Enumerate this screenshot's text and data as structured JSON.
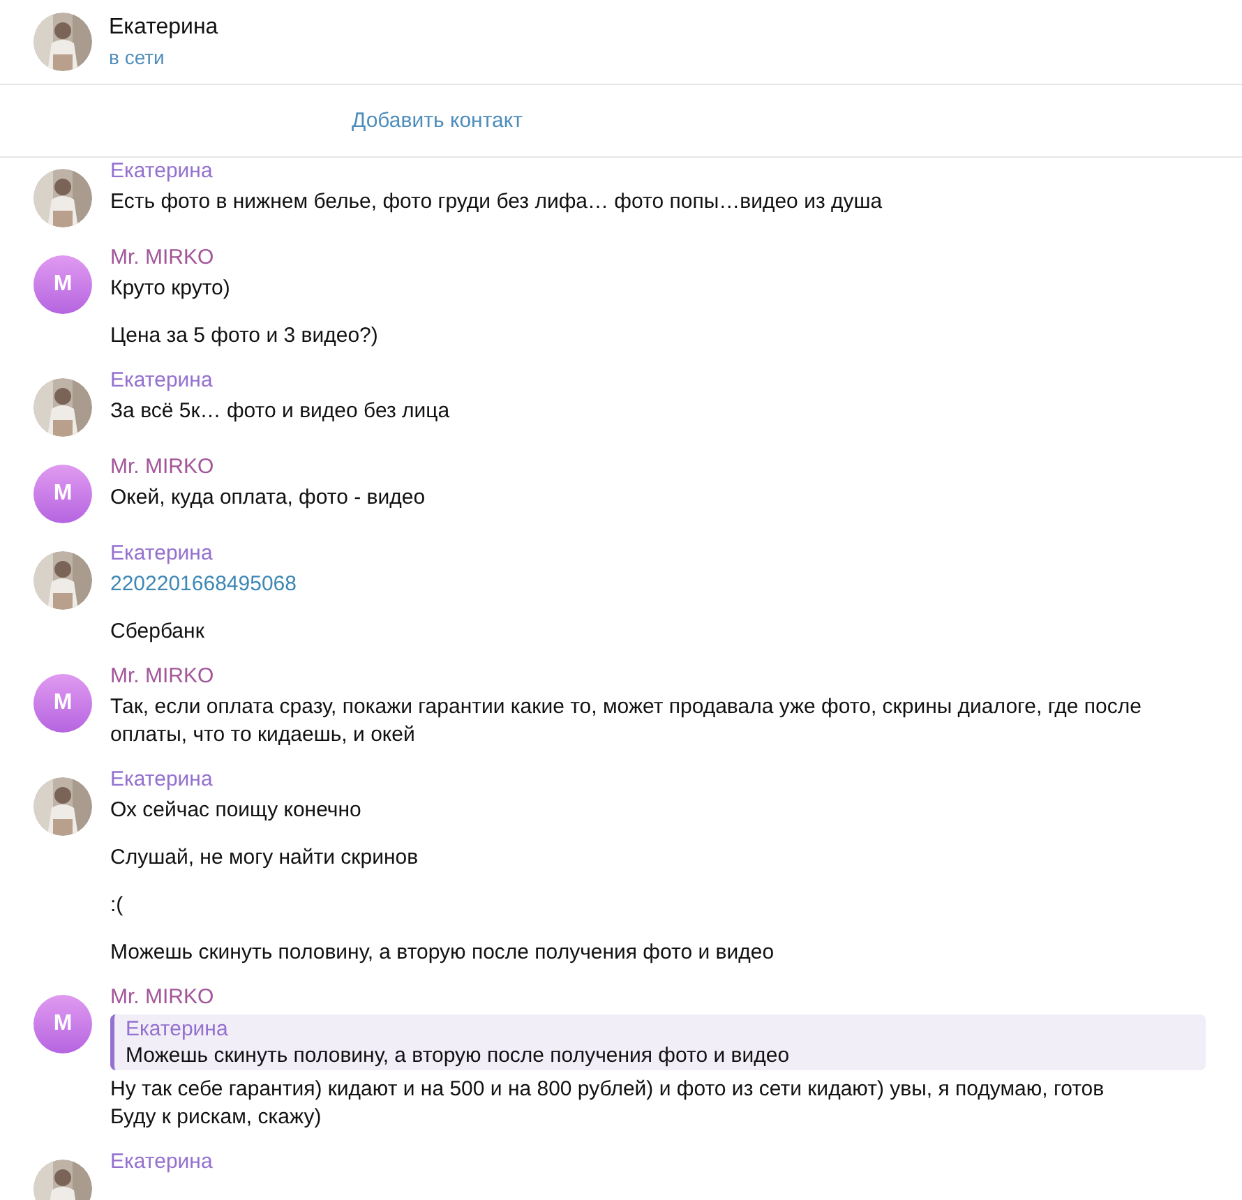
{
  "header": {
    "name": "Екатерина",
    "status": "в сети",
    "avatar": {
      "kind": "picture"
    }
  },
  "add_contact": "Добавить контакт",
  "groups": [
    {
      "sender": "Екатерина",
      "color": "#9470cf",
      "avatar": {
        "kind": "picture"
      },
      "messages": [
        {
          "kind": "text",
          "text": "Есть фото в нижнем белье, фото груди без лифа… фото попы…видео из душа"
        }
      ]
    },
    {
      "sender": "Mr. MIRKO",
      "color": "#a3559a",
      "avatar": {
        "kind": "letter",
        "letter": "M"
      },
      "messages": [
        {
          "kind": "text",
          "text": "Круто круто)"
        },
        {
          "kind": "text",
          "text": "Цена за 5 фото и 3 видео?)"
        }
      ]
    },
    {
      "sender": "Екатерина",
      "color": "#9470cf",
      "avatar": {
        "kind": "picture"
      },
      "messages": [
        {
          "kind": "text",
          "text": "За всё 5к… фото и видео без лица"
        }
      ]
    },
    {
      "sender": "Mr. MIRKO",
      "color": "#a3559a",
      "avatar": {
        "kind": "letter",
        "letter": "M"
      },
      "messages": [
        {
          "kind": "text",
          "text": "Окей, куда оплата, фото - видео"
        }
      ]
    },
    {
      "sender": "Екатерина",
      "color": "#9470cf",
      "avatar": {
        "kind": "picture"
      },
      "messages": [
        {
          "kind": "link",
          "text": "2202201668495068"
        },
        {
          "kind": "text",
          "text": "Сбербанк"
        }
      ]
    },
    {
      "sender": "Mr. MIRKO",
      "color": "#a3559a",
      "avatar": {
        "kind": "letter",
        "letter": "M"
      },
      "messages": [
        {
          "kind": "text",
          "text": "Так, если оплата сразу,  покажи гарантии какие то, может продавала уже фото, скрины диалоге, где после оплаты, что то кидаешь, и окей"
        }
      ]
    },
    {
      "sender": "Екатерина",
      "color": "#9470cf",
      "avatar": {
        "kind": "picture"
      },
      "messages": [
        {
          "kind": "text",
          "text": "Ох сейчас поищу конечно"
        },
        {
          "kind": "text",
          "text": "Слушай, не могу найти скринов"
        },
        {
          "kind": "text",
          "text": ":("
        },
        {
          "kind": "text",
          "text": "Можешь скинуть половину, а вторую после получения фото и видео"
        }
      ]
    },
    {
      "sender": "Mr. MIRKO",
      "color": "#a3559a",
      "avatar": {
        "kind": "letter",
        "letter": "M"
      },
      "messages": [
        {
          "kind": "reply",
          "author": "Екатерина",
          "quote": "Можешь скинуть половину, а вторую после получения фото и видео",
          "text": "Ну так себе гарантия) кидают и на 500 и на 800 рублей) и фото из сети кидают) увы, я подумаю, готов\nБуду к рискам, скажу)"
        }
      ]
    },
    {
      "sender": "Екатерина",
      "color": "#9470cf",
      "avatar": {
        "kind": "picture"
      }
    }
  ]
}
